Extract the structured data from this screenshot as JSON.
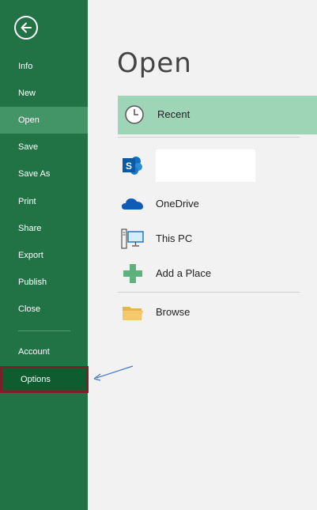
{
  "sidebar": {
    "items": [
      {
        "label": "Info"
      },
      {
        "label": "New"
      },
      {
        "label": "Open"
      },
      {
        "label": "Save"
      },
      {
        "label": "Save As"
      },
      {
        "label": "Print"
      },
      {
        "label": "Share"
      },
      {
        "label": "Export"
      },
      {
        "label": "Publish"
      },
      {
        "label": "Close"
      },
      {
        "label": "Account"
      },
      {
        "label": "Options"
      }
    ],
    "active": "Open",
    "highlighted": "Options"
  },
  "main": {
    "title": "Open",
    "recent_label": "Recent",
    "places": [
      {
        "label": "",
        "icon": "sharepoint-icon"
      },
      {
        "label": "OneDrive",
        "icon": "onedrive-icon"
      },
      {
        "label": "This PC",
        "icon": "computer-icon"
      },
      {
        "label": "Add a Place",
        "icon": "plus-icon"
      },
      {
        "label": "Browse",
        "icon": "folder-icon"
      }
    ]
  },
  "colors": {
    "sidebar": "#217346",
    "active_item": "#439467",
    "recent_highlight": "#9fd5b7",
    "options_border": "#7b1f2a"
  }
}
